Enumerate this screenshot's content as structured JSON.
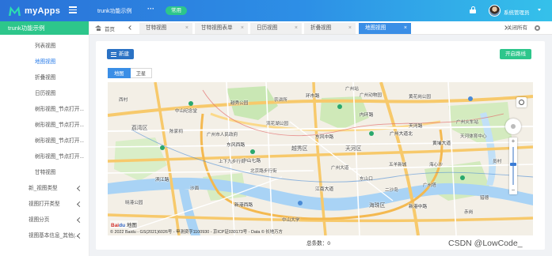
{
  "header": {
    "app_name": "myApps",
    "title": "trunk功能示例",
    "more": "···",
    "badge": "常用",
    "user": "系统管理员"
  },
  "sidebar": {
    "title": "trunk功能示例",
    "items": [
      {
        "label": "列表视图",
        "active": false
      },
      {
        "label": "地图视图",
        "active": true
      },
      {
        "label": "折叠视图",
        "active": false
      },
      {
        "label": "日历视图",
        "active": false
      },
      {
        "label": "树形视图_节点打开...",
        "active": false
      },
      {
        "label": "树形视图_节点打开...",
        "active": false
      },
      {
        "label": "树形视图_节点打开...",
        "active": false
      },
      {
        "label": "树形视图_节点打开...",
        "active": false
      },
      {
        "label": "甘特视图",
        "active": false
      }
    ],
    "groups": [
      {
        "label": "新_视图类型"
      },
      {
        "label": "视图打开类型"
      },
      {
        "label": "视图分页"
      },
      {
        "label": "视图基本信息_其他(..."
      }
    ]
  },
  "tabs": {
    "home": "首页",
    "items": [
      {
        "label": "甘特视图",
        "active": false
      },
      {
        "label": "甘特视图表单",
        "active": false
      },
      {
        "label": "日历视图",
        "active": false
      },
      {
        "label": "折叠视图",
        "active": false
      },
      {
        "label": "地图视图",
        "active": true
      }
    ],
    "close_glyph": "×",
    "close_all": "关闭所有"
  },
  "toolbar": {
    "new_label": "新建",
    "route_label": "开启路线"
  },
  "map": {
    "type_tabs": [
      "地图",
      "卫星"
    ],
    "selected_type": "地图",
    "logo_red": "Bai",
    "logo_blue": "du",
    "logo_suffix": "地图",
    "copyright": "© 2022 Baidu - GS(2021)6026号 - 甲测资字1100930 - 京ICP证030173号 - Data © 长地万方",
    "zoom_level": 0.55,
    "labels": {
      "l1": "广州站",
      "l2": "广州动物园",
      "l3": "越秀公园",
      "l4": "流花湖公园",
      "l5": "中山纪念堂",
      "l6": "广州市人民政府",
      "l7": "农讲所",
      "l8": "北京路步行街",
      "l9": "越秀区",
      "l10": "荔湾区",
      "l11": "海珠区",
      "l12": "天河区",
      "l13": "广州塔",
      "l14": "海心沙",
      "l15": "沙面",
      "l16": "上下九步行街",
      "l17": "陈家祠",
      "l18": "西村",
      "l19": "广州火车站",
      "l20": "黄花岗公园",
      "l21": "天河体育中心",
      "l22": "中山大学",
      "l23": "晓港公园",
      "l24": "赤岗",
      "l25": "员村",
      "l26": "猎德",
      "l27": "五羊新城",
      "l28": "二沙岛",
      "l29": "广州大道",
      "l30": "东山口"
    },
    "roads": {
      "r1": "环市路",
      "r2": "东风西路",
      "r3": "东风中路",
      "r4": "中山七路",
      "r5": "内环路",
      "r6": "广州大道北",
      "r7": "天河路",
      "r8": "黄埔大道",
      "r9": "新港西路",
      "r10": "新港中路",
      "r11": "江南大道",
      "r12": "滨江路"
    }
  },
  "footer": {
    "total": "总条数：0"
  },
  "watermark": "CSDN @LowCode_"
}
